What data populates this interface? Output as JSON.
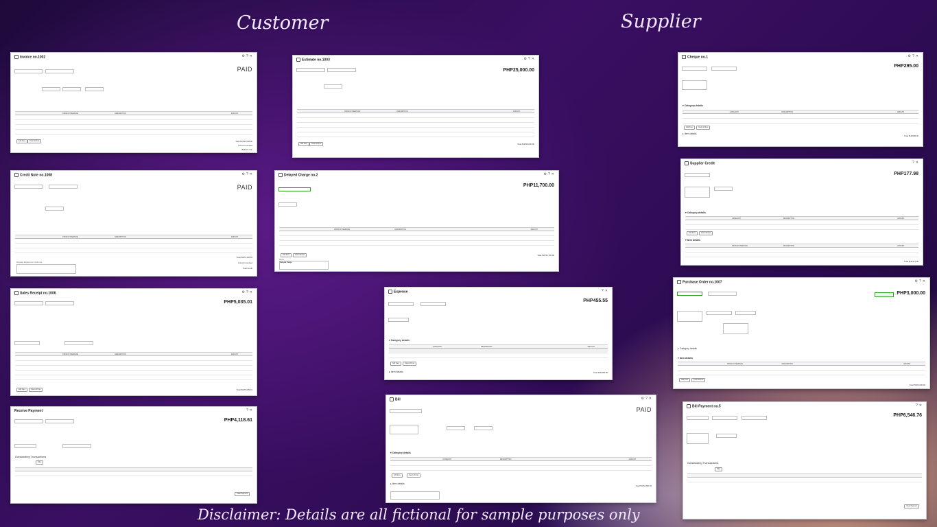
{
  "headings": {
    "customer": "Customer",
    "supplier": "Supplier",
    "disclaimer": "Disclaimer: Details are all fictional for sample purposes only"
  },
  "windows": {
    "invoice": {
      "title": "Invoice no.1002",
      "status": "PAID",
      "total": "PHP11,600.00",
      "balance_label": "Balance due",
      "total_label": "Total",
      "amount_received_label": "Amount received"
    },
    "estimate": {
      "title": "Estimate no.1003",
      "amount": "PHP25,000.00",
      "total_label": "Total",
      "total": "PHP25,000.00"
    },
    "credit_note": {
      "title": "Credit Note no.1008",
      "status": "PAID",
      "total": "PHP1,432.52",
      "total_label": "Total",
      "amount_received_label": "Amount received",
      "total_credit_label": "Total Credit",
      "memo_label": "Message displayed on credit note"
    },
    "delayed_charge": {
      "title": "Delayed Charge no.2",
      "amount": "PHP11,700.00",
      "total_label": "Total",
      "total": "PHP11,700.00",
      "memo_label": "Memo",
      "memo_value": "Delayed charge"
    },
    "sales_receipt": {
      "title": "Sales Receipt no.1006",
      "amount": "PHP5,035.01",
      "total_label": "Total",
      "total": "PHP5,035.01"
    },
    "receive_payment": {
      "title": "Receive Payment",
      "amount": "PHP4,118.61",
      "section": "Outstanding Transactions",
      "filter_label": "Filter",
      "clear_label": "Clear Payment"
    },
    "expense": {
      "title": "Expense",
      "amount": "PHP455.55",
      "category_section": "Category details",
      "item_section": "Item details",
      "total_label": "Total",
      "total": "PHP455.55"
    },
    "bill": {
      "title": "Bill",
      "status": "PAID",
      "category_section": "Category details",
      "item_section": "Item details",
      "total_label": "Total",
      "total": "PHP2,000.00"
    },
    "cheque": {
      "title": "Cheque no.1",
      "amount": "PHP295.00",
      "category_section": "Category details",
      "item_section": "Item details",
      "total_label": "Total",
      "total": "PHP295.00"
    },
    "supplier_credit": {
      "title": "Supplier Credit",
      "amount": "PHP177.98",
      "category_section": "Category details",
      "item_section": "Item details",
      "total_label": "Total",
      "total": "PHP177.98"
    },
    "purchase_order": {
      "title": "Purchase Order no.1007",
      "amount": "PHP3,000.00",
      "category_section": "Category details",
      "item_section": "Item details",
      "total_label": "Total",
      "total": "PHP3,000.00"
    },
    "bill_payment": {
      "title": "Bill Payment no.5",
      "amount": "PHP6,546.76",
      "section": "Outstanding Transactions",
      "filter_label": "Filter",
      "clear_label": "Clear Payment"
    }
  },
  "common": {
    "add_lines": "Add lines",
    "clear_all": "Clear all lines",
    "amount_label": "AMOUNT",
    "product_label": "PRODUCT/SERVICE",
    "description_label": "DESCRIPTION",
    "category_label": "CATEGORY",
    "close_icon": "close-icon",
    "gear_icon": "gear-icon",
    "help_icon": "help-icon"
  },
  "colors": {
    "accent_green": "#2ca01c",
    "bg_purple": "#2a0b4e"
  }
}
